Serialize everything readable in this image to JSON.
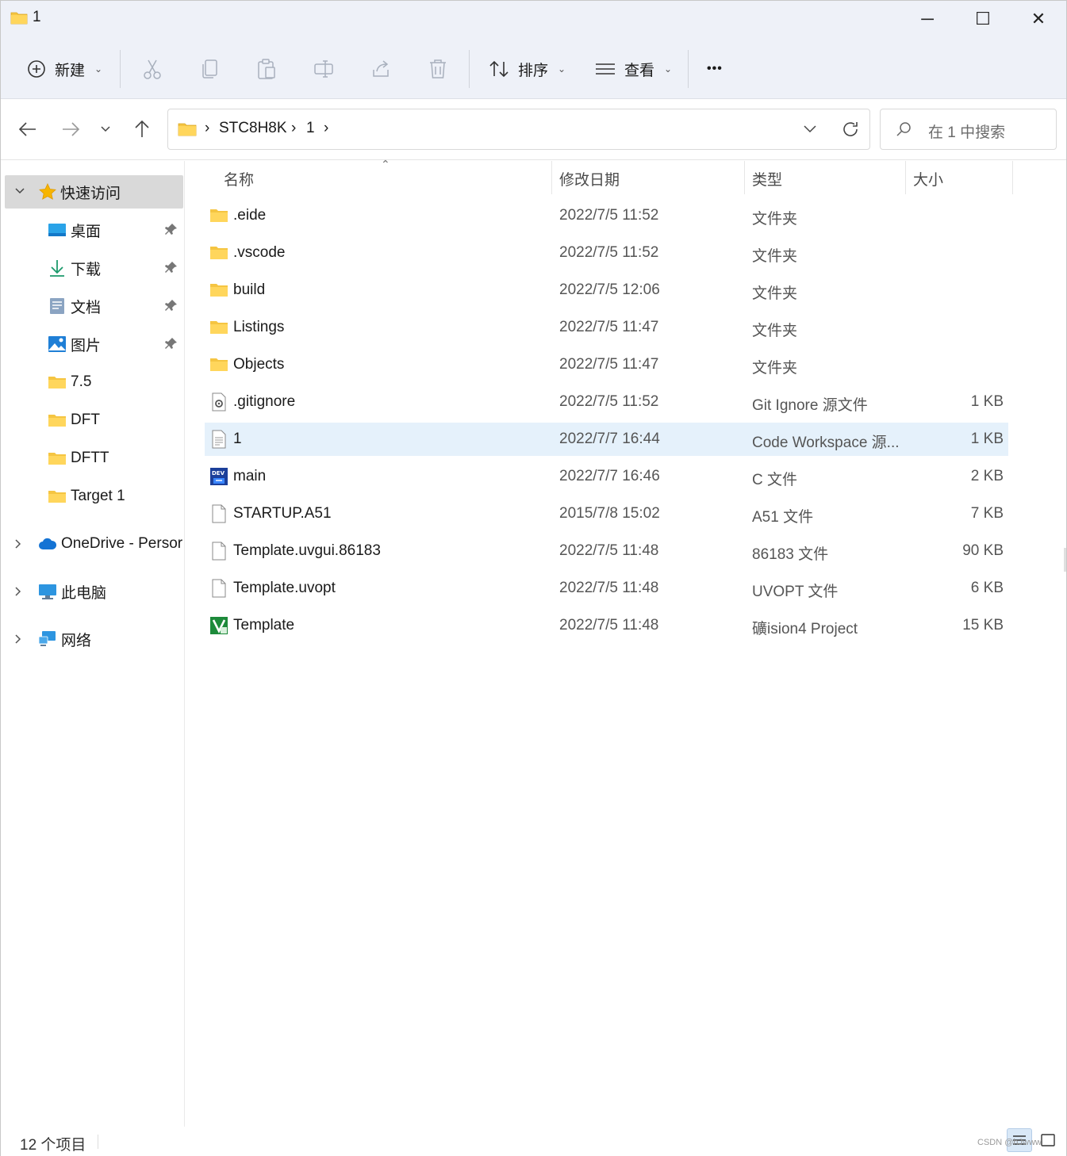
{
  "window": {
    "title": "1",
    "min": "─",
    "max": "☐",
    "close": "✕"
  },
  "toolbar": {
    "new_label": "新建",
    "sort_label": "排序",
    "view_label": "查看",
    "more_label": "•••"
  },
  "nav": {
    "breadcrumb": [
      "STC8H8K",
      "1"
    ],
    "search_placeholder": "在 1 中搜索"
  },
  "sidebar": {
    "quick_access": "快速访问",
    "items": [
      {
        "label": "桌面",
        "icon": "desktop-icon",
        "pinned": true
      },
      {
        "label": "下载",
        "icon": "download-icon",
        "pinned": true
      },
      {
        "label": "文档",
        "icon": "document-icon",
        "pinned": true
      },
      {
        "label": "图片",
        "icon": "picture-icon",
        "pinned": true
      },
      {
        "label": "7.5",
        "icon": "folder-icon",
        "pinned": false
      },
      {
        "label": "DFT",
        "icon": "folder-icon",
        "pinned": false
      },
      {
        "label": "DFTT",
        "icon": "folder-icon",
        "pinned": false
      },
      {
        "label": "Target 1",
        "icon": "folder-icon",
        "pinned": false
      }
    ],
    "onedrive": "OneDrive - Persor",
    "this_pc": "此电脑",
    "network": "网络"
  },
  "list": {
    "columns": {
      "name": "名称",
      "date": "修改日期",
      "type": "类型",
      "size": "大小"
    },
    "rows": [
      {
        "name": ".eide",
        "date": "2022/7/5 11:52",
        "type": "文件夹",
        "size": "",
        "icon": "folder-icon"
      },
      {
        "name": ".vscode",
        "date": "2022/7/5 11:52",
        "type": "文件夹",
        "size": "",
        "icon": "folder-icon"
      },
      {
        "name": "build",
        "date": "2022/7/5 12:06",
        "type": "文件夹",
        "size": "",
        "icon": "folder-icon"
      },
      {
        "name": "Listings",
        "date": "2022/7/5 11:47",
        "type": "文件夹",
        "size": "",
        "icon": "folder-icon"
      },
      {
        "name": "Objects",
        "date": "2022/7/5 11:47",
        "type": "文件夹",
        "size": "",
        "icon": "folder-icon"
      },
      {
        "name": ".gitignore",
        "date": "2022/7/5 11:52",
        "type": "Git Ignore 源文件",
        "size": "1 KB",
        "icon": "gear-file-icon"
      },
      {
        "name": "1",
        "date": "2022/7/7 16:44",
        "type": "Code Workspace 源...",
        "size": "1 KB",
        "icon": "text-file-icon"
      },
      {
        "name": "main",
        "date": "2022/7/7 16:46",
        "type": "C 文件",
        "size": "2 KB",
        "icon": "devcpp-file-icon"
      },
      {
        "name": "STARTUP.A51",
        "date": "2015/7/8 15:02",
        "type": "A51 文件",
        "size": "7 KB",
        "icon": "blank-file-icon"
      },
      {
        "name": "Template.uvgui.86183",
        "date": "2022/7/5 11:48",
        "type": "86183 文件",
        "size": "90 KB",
        "icon": "blank-file-icon"
      },
      {
        "name": "Template.uvopt",
        "date": "2022/7/5 11:48",
        "type": "UVOPT 文件",
        "size": "6 KB",
        "icon": "blank-file-icon"
      },
      {
        "name": "Template",
        "date": "2022/7/5 11:48",
        "type": "礦ision4 Project",
        "size": "15 KB",
        "icon": "keil-project-icon"
      }
    ]
  },
  "status": {
    "count": "12 个项目",
    "watermark": "CSDN @hJwww"
  },
  "colors": {
    "selected_row": "#e5f1fb",
    "chrome_bg": "#eef1f8",
    "folder": "#f5c542"
  }
}
